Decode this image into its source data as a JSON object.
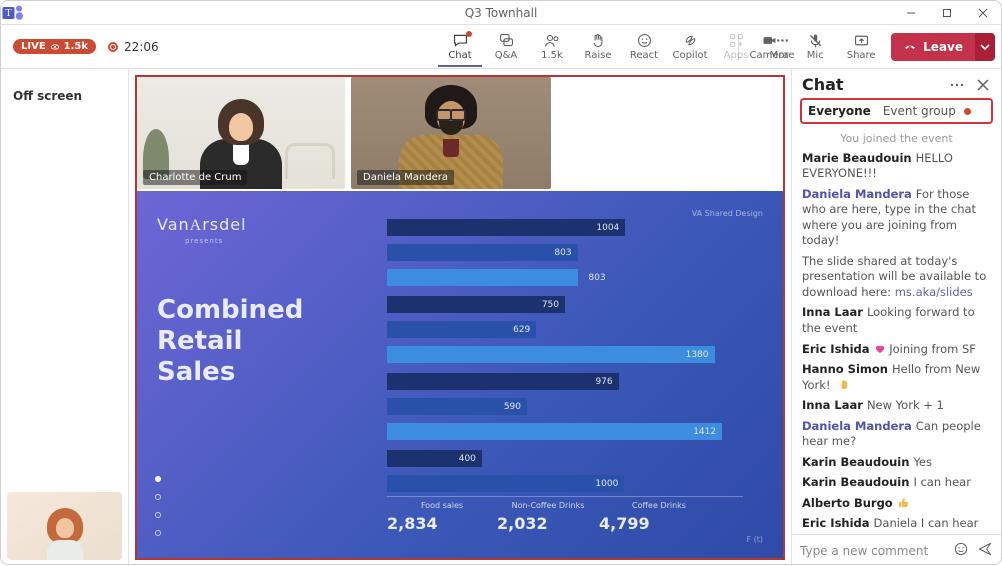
{
  "window": {
    "title": "Q3 Townhall"
  },
  "status": {
    "live": "LIVE",
    "viewers_suffix": "1.5k",
    "rec_time": "22:06"
  },
  "tools": {
    "chat": {
      "label": "Chat"
    },
    "qa": {
      "label": "Q&A"
    },
    "people": {
      "label": "1.5k",
      "aria": "People"
    },
    "raise": {
      "label": "Raise"
    },
    "react": {
      "label": "React"
    },
    "copilot": {
      "label": "Copilot"
    },
    "apps": {
      "label": "Apps"
    },
    "more": {
      "label": "More"
    },
    "camera": {
      "label": "Camera"
    },
    "mic": {
      "label": "Mic"
    },
    "share": {
      "label": "Share"
    },
    "leave": {
      "label": "Leave"
    }
  },
  "offscreen_label": "Off screen",
  "videos": {
    "tile1_name": "Charlotte de Crum",
    "tile2_name": "Daniela Mandera"
  },
  "slide": {
    "brand_1": "Van",
    "brand_2": "A",
    "brand_3": "rsdel",
    "presents": "presents",
    "heading_1": "Combined",
    "heading_2": "Retail",
    "heading_3": "Sales",
    "credit": "VA Shared Design",
    "footer_label": "F (t)",
    "categories": {
      "c1": "Food sales",
      "c2": "Non-Coffee Drinks",
      "c3": "Coffee Drinks"
    },
    "totals": {
      "c1": "2,834",
      "c2": "2,032",
      "c3": "4,799"
    }
  },
  "chat_panel": {
    "title": "Chat",
    "tabs": {
      "everyone": "Everyone",
      "event_group": "Event group"
    },
    "system": "You joined the event",
    "messages": [
      {
        "author": "Marie Beaudouin",
        "org": false,
        "text": "HELLO EVERYONE!!!"
      },
      {
        "author": "Daniela Mandera",
        "org": true,
        "text": "For those who are here, type in the chat where you are joining from today!"
      },
      {
        "author": "",
        "org": false,
        "text_pre": "The slide shared at today's presentation will be available to download here: ",
        "link": "ms.aka/slides"
      },
      {
        "author": "Inna Laar",
        "org": false,
        "text": "Looking forward to the event"
      },
      {
        "author": "Eric Ishida",
        "org": false,
        "heart": true,
        "text": "Joining from SF"
      },
      {
        "author": "Hanno Simon",
        "org": false,
        "text": "Hello from New York!",
        "wave": true
      },
      {
        "author": "Inna Laar",
        "org": false,
        "text": "New York + 1"
      },
      {
        "author": "Daniela Mandera",
        "org": true,
        "text": "Can people hear me?"
      },
      {
        "author": "Karin Beaudouin",
        "org": false,
        "text": "Yes"
      },
      {
        "author": "Karin Beaudouin",
        "org": false,
        "text": "I can hear"
      },
      {
        "author": "Alberto Burgo",
        "org": false,
        "thumb": true,
        "text": ""
      },
      {
        "author": "Eric Ishida",
        "org": false,
        "text": "Daniela I can hear you"
      }
    ],
    "input_placeholder": "Type a new comment"
  },
  "chart_data": {
    "type": "bar",
    "orientation": "horizontal",
    "title": "Combined Retail Sales",
    "xlabel": "",
    "ylabel": "",
    "grouping": "category triplets (Food / Non-Coffee / Coffee)",
    "series": [
      {
        "name": "Food sales",
        "color": "#1b326e",
        "values": [
          1004,
          750,
          976,
          400
        ]
      },
      {
        "name": "Non-Coffee Drinks",
        "color": "#2a51aa",
        "values": [
          803,
          629,
          590,
          1000
        ]
      },
      {
        "name": "Coffee Drinks",
        "color": "#3c8de0",
        "values": [
          803,
          1380,
          1412,
          0
        ],
        "note": "third-group value is right-labelled; fourth Coffee bar not shown on slide"
      }
    ],
    "xlim": [
      0,
      1500
    ],
    "category_totals": {
      "Food sales": 2834,
      "Non-Coffee Drinks": 2032,
      "Coffee Drinks": 4799
    }
  }
}
